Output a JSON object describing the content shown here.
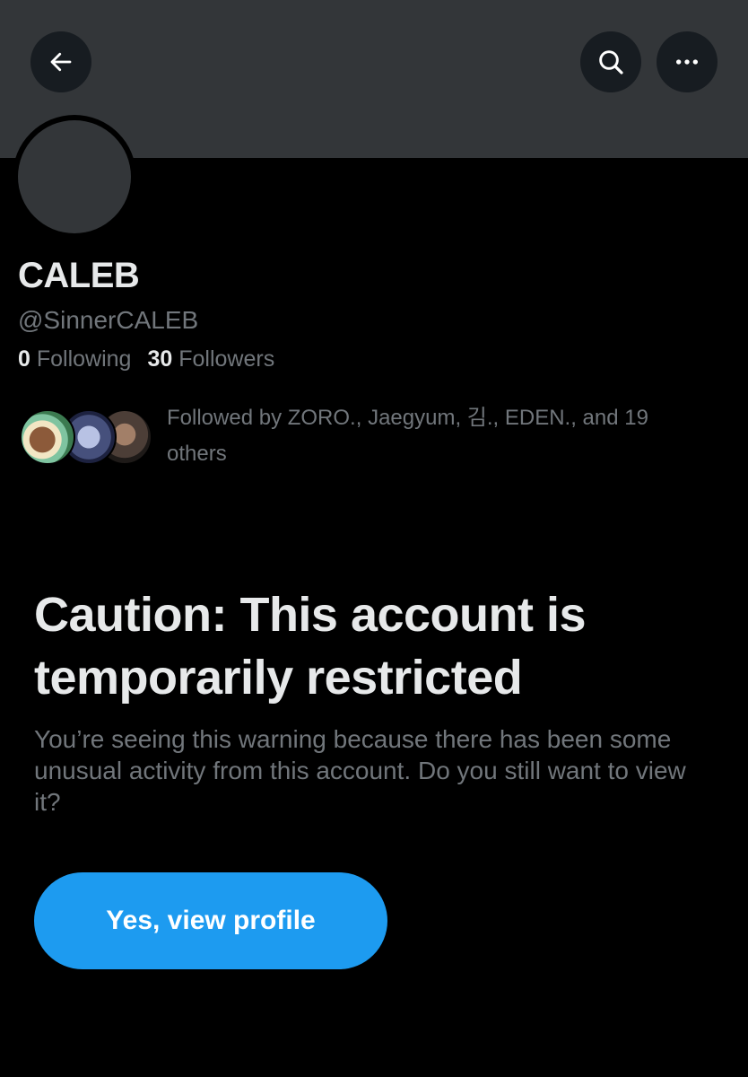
{
  "header": {
    "back_icon": "arrow-left-icon",
    "search_icon": "search-icon",
    "more_icon": "more-horizontal-icon"
  },
  "profile": {
    "display_name": "CALEB",
    "handle": "@SinnerCALEB",
    "following_count": "0",
    "following_label": "Following",
    "followers_count": "30",
    "followers_label": "Followers",
    "followed_by_text": "Followed by ZORO., Jaegyum, 김., EDEN., and 19 others"
  },
  "warning": {
    "title": "Caution: This account is temporarily restricted",
    "body": "You’re seeing this warning because there has been some unusual activity from this account. Do you still want to view it?",
    "button_label": "Yes, view profile"
  },
  "colors": {
    "background": "#000000",
    "banner": "#333639",
    "primary_text": "#e7e9ea",
    "secondary_text": "#71767b",
    "accent": "#1d9bf0"
  }
}
